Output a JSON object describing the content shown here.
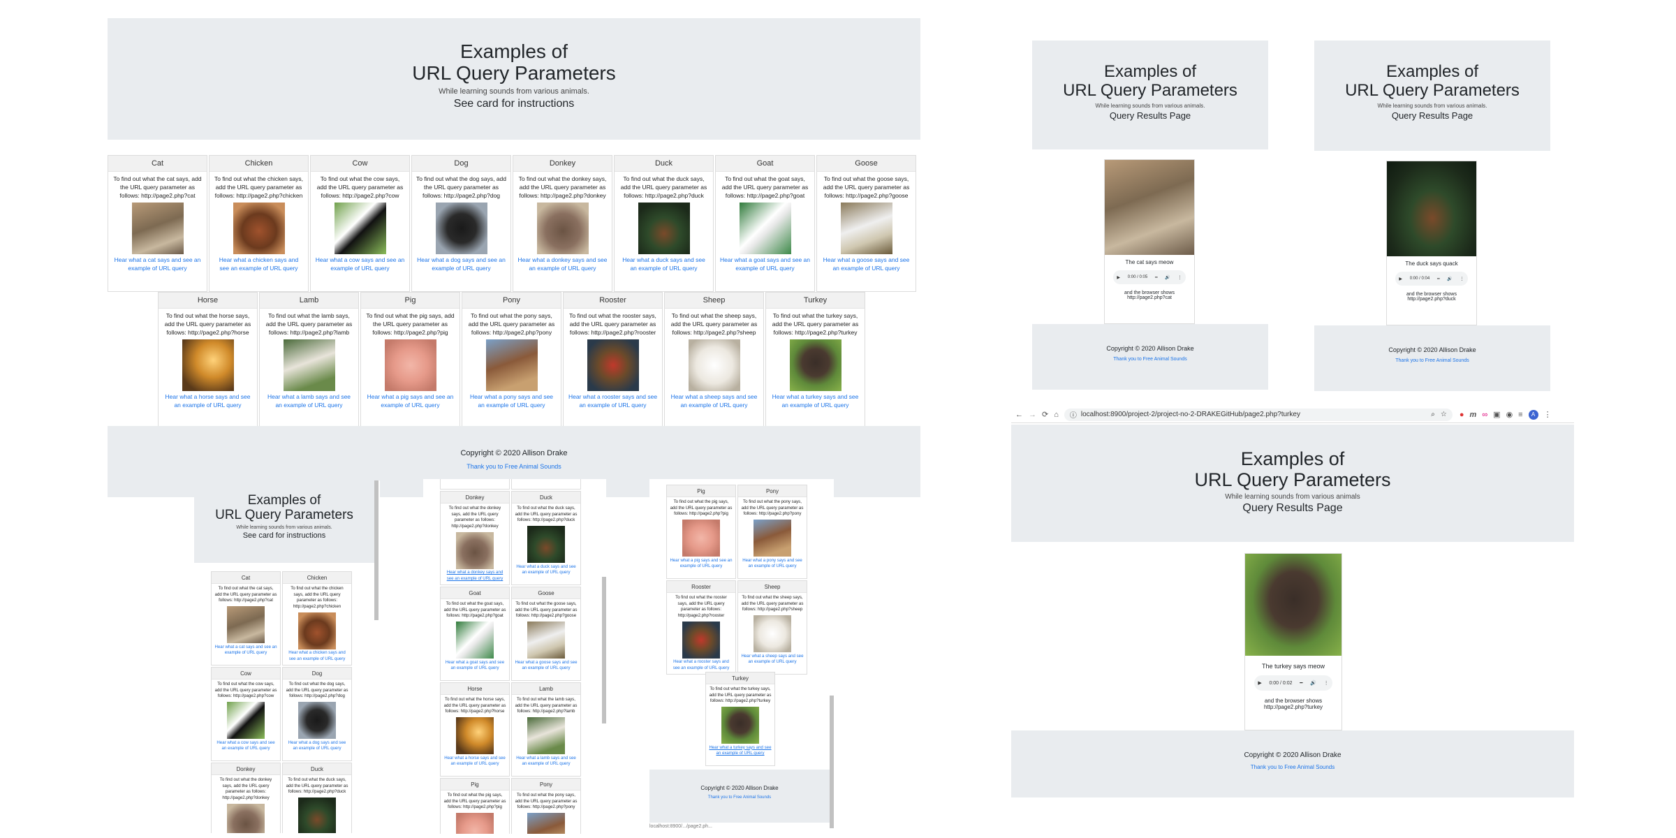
{
  "app": {
    "title_l1": "Examples of",
    "title_l2": "URL Query Parameters",
    "tagline": "While learning sounds from various animals.",
    "tagline_nodot": "While learning sounds from various animals",
    "instructions": "See card for instructions",
    "results_title": "Query Results Page",
    "copyright": "Copyright © 2020 Allison Drake",
    "thanks": "Thank you to Free Animal Sounds"
  },
  "animals": [
    {
      "name": "Cat",
      "desc": "To find out what the cat says, add the URL query parameter as follows: http://page2.php?cat",
      "link": "Hear what a cat says and see an example of URL query"
    },
    {
      "name": "Chicken",
      "desc": "To find out what the chicken says, add the URL query parameter as follows: http://page2.php?chicken",
      "link": "Hear what a chicken says and see an example of URL query"
    },
    {
      "name": "Cow",
      "desc": "To find out what the cow says, add the URL query parameter as follows: http://page2.php?cow",
      "link": "Hear what a cow says and see an example of URL query"
    },
    {
      "name": "Dog",
      "desc": "To find out what the dog says, add the URL query parameter as follows: http://page2.php?dog",
      "link": "Hear what a dog says and see an example of URL query"
    },
    {
      "name": "Donkey",
      "desc": "To find out what the donkey says, add the URL query parameter as follows: http://page2.php?donkey",
      "link": "Hear what a donkey says and see an example of URL query"
    },
    {
      "name": "Duck",
      "desc": "To find out what the duck says, add the URL query parameter as follows: http://page2.php?duck",
      "link": "Hear what a duck says and see an example of URL query"
    },
    {
      "name": "Goat",
      "desc": "To find out what the goat says, add the URL query parameter as follows: http://page2.php?goat",
      "link": "Hear what a goat says and see an example of URL query"
    },
    {
      "name": "Goose",
      "desc": "To find out what the goose says, add the URL query parameter as follows: http://page2.php?goose",
      "link": "Hear what a goose says and see an example of URL query"
    },
    {
      "name": "Horse",
      "desc": "To find out what the horse says, add the URL query parameter as follows: http://page2.php?horse",
      "link": "Hear what a horse says and see an example of URL query"
    },
    {
      "name": "Lamb",
      "desc": "To find out what the lamb says, add the URL query parameter as follows: http://page2.php?lamb",
      "link": "Hear what a lamb says and see an example of URL query"
    },
    {
      "name": "Pig",
      "desc": "To find out what the pig says, add the URL query parameter as follows: http://page2.php?pig",
      "link": "Hear what a pig says and see an example of URL query"
    },
    {
      "name": "Pony",
      "desc": "To find out what the pony says, add the URL query parameter as follows: http://page2.php?pony",
      "link": "Hear what a pony says and see an example of URL query"
    },
    {
      "name": "Rooster",
      "desc": "To find out what the rooster says, add the URL query parameter as follows: http://page2.php?rooster",
      "link": "Hear what a rooster says and see an example of URL query"
    },
    {
      "name": "Sheep",
      "desc": "To find out what the sheep says, add the URL query parameter as follows: http://page2.php?sheep",
      "link": "Hear what a sheep says and see an example of URL query"
    },
    {
      "name": "Turkey",
      "desc": "To find out what the turkey says, add the URL query parameter as follows: http://page2.php?turkey",
      "link": "Hear what a turkey says and see an example of URL query"
    }
  ],
  "results": [
    {
      "says": "The cat says meow",
      "time": "0:00 / 0:05",
      "shows": "and the browser shows",
      "url": "http://page2.php?cat"
    },
    {
      "says": "The duck says quack",
      "time": "0:00 / 0:04",
      "shows": "and the browser shows",
      "url": "http://page2.php?duck"
    },
    {
      "says": "The turkey says meow",
      "time": "0:00 / 0:02",
      "shows": "and the browser shows",
      "url": "http://page2.php?turkey"
    }
  ],
  "browser": {
    "url": "localhost:8900/project-2/project-no-2-DRAKEGitHub/page2.php?turkey",
    "avatar": "A",
    "status": "localhost:8900/.../page2.ph..."
  },
  "colors": {
    "jumbotron": "#e9ecef",
    "link": "#1a73e8",
    "card_header": "#f1f1f1"
  }
}
